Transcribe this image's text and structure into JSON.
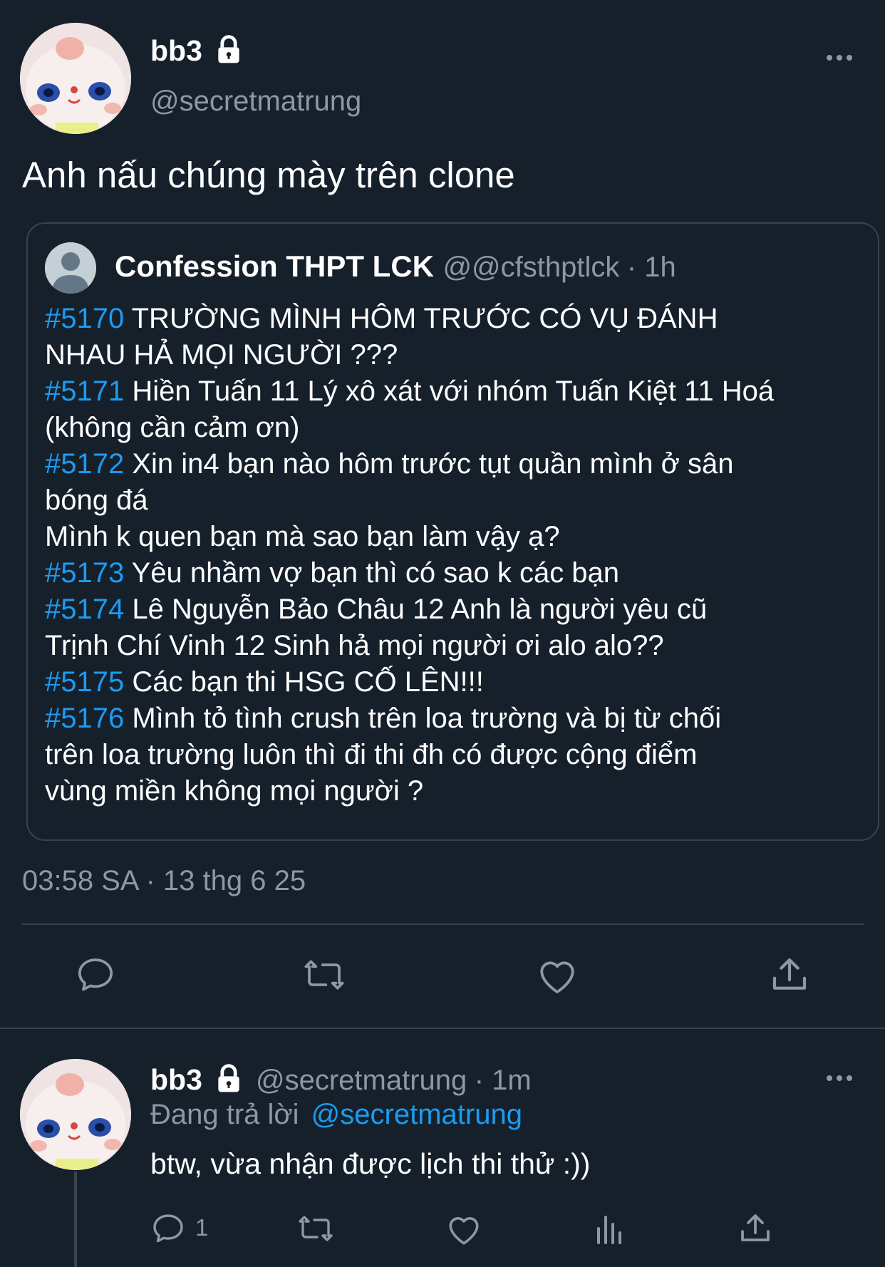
{
  "tweet": {
    "display_name": "bb3",
    "handle": "@secretmatrung",
    "text": "Anh nấu chúng mày trên clone",
    "timestamp": "03:58 SA · 13 thg 6 25",
    "icons": {
      "lock": "lock-icon",
      "more": "more-icon"
    }
  },
  "quote": {
    "display_name": "Confession THPT LCK",
    "handle": "@@cfsthptlck",
    "time": "· 1h",
    "lines": [
      {
        "tag": "#5170",
        "text": " TRƯỜNG MÌNH HÔM TRƯỚC CÓ VỤ ĐÁNH"
      },
      {
        "tag": "",
        "text": "NHAU HẢ MỌI NGƯỜI ???"
      },
      {
        "tag": "#5171",
        "text": " Hiền Tuấn 11 Lý xô xát với nhóm Tuấn Kiệt 11 Hoá"
      },
      {
        "tag": "",
        "text": "(không cần cảm ơn)"
      },
      {
        "tag": "#5172",
        "text": " Xin in4 bạn nào hôm trước tụt quần mình ở sân"
      },
      {
        "tag": "",
        "text": "bóng đá"
      },
      {
        "tag": "",
        "text": "Mình k quen bạn mà sao bạn làm vậy ạ?"
      },
      {
        "tag": "#5173",
        "text": " Yêu nhầm vợ bạn thì có sao k các bạn"
      },
      {
        "tag": "#5174",
        "text": " Lê Nguyễn Bảo Châu 12 Anh là người yêu cũ"
      },
      {
        "tag": "",
        "text": "Trịnh Chí Vinh 12 Sinh hả mọi người ơi alo alo??"
      },
      {
        "tag": "#5175",
        "text": " Các bạn thi HSG CỐ LÊN!!!"
      },
      {
        "tag": "#5176",
        "text": " Mình tỏ tình crush trên loa trường và bị từ chối"
      },
      {
        "tag": "",
        "text": "trên loa trường luôn thì đi thi đh có được cộng điểm"
      },
      {
        "tag": "",
        "text": "vùng miền không mọi người ?"
      }
    ]
  },
  "actions": [
    "reply-icon",
    "retweet-icon",
    "like-icon",
    "share-icon"
  ],
  "reply": {
    "display_name": "bb3",
    "handle": "@secretmatrung",
    "time": "· 1m",
    "replying_prefix": "Đang trả lời",
    "replying_to": "@secretmatrung",
    "text": "btw, vừa nhận được lịch thi thử :))",
    "reply_count": "1",
    "actions": [
      "reply-icon",
      "retweet-icon",
      "like-icon",
      "analytics-icon",
      "share-icon"
    ]
  },
  "colors": {
    "background": "#15202b",
    "accent": "#1d9bf0",
    "secondary_text": "#8b98a5",
    "border": "#38444d"
  }
}
